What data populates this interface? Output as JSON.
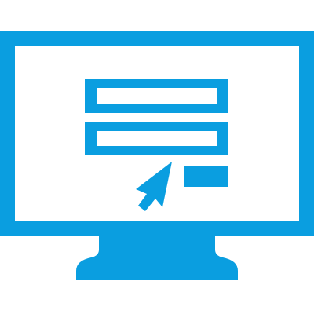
{
  "icon": {
    "name": "computer-monitor-form-icon",
    "color": "#0a9ee0",
    "background": "#ffffff",
    "parts": [
      "monitor-frame",
      "monitor-screen",
      "form-field-1",
      "form-field-2",
      "submit-button",
      "mouse-cursor",
      "monitor-stand"
    ]
  }
}
